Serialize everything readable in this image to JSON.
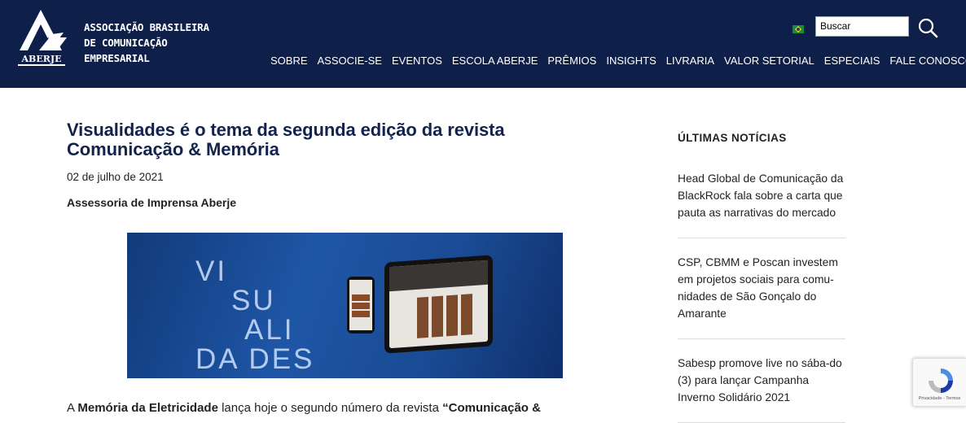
{
  "header": {
    "logo_text": "ABERJE",
    "org_name": [
      "ASSOCIAÇÃO BRASILEIRA",
      "DE COMUNICAÇÃO",
      "EMPRESARIAL"
    ],
    "search_placeholder": "Buscar",
    "nav": [
      "SOBRE",
      "ASSOCIE-SE",
      "EVENTOS",
      "ESCOLA ABERJE",
      "PRÊMIOS",
      "INSIGHTS",
      "LIVRARIA",
      "VALOR SETORIAL",
      "ESPECIAIS",
      "FALE CONOSCO"
    ],
    "colors": {
      "bg": "#0e1f4a",
      "text": "#ffffff"
    }
  },
  "article": {
    "title": "Visualidades é o tema da segunda edição da revista Comunicação & Memória",
    "date": "02 de julho de 2021",
    "author": "Assessoria de Imprensa Aberje",
    "hero_word": [
      "VI",
      "SU",
      "ALI",
      "DA DES"
    ],
    "body_start": {
      "a": "A ",
      "b": "Memória da Eletricidade",
      "c": " lança hoje o segundo número da revista ",
      "d": "“Comunicação &"
    }
  },
  "sidebar": {
    "title": "ÚLTIMAS NOTÍCIAS",
    "items": [
      {
        "label": "Head Global de Comunicação da BlackRock fala sobre a carta que pauta as narrativas do mercado"
      },
      {
        "label": "CSP, CBMM e Poscan investem em projetos sociais para comu-nidades de São Gonçalo do Amarante"
      },
      {
        "label": "Sabesp promove live no sába-do (3) para lançar Campanha Inverno Solidário 2021"
      }
    ]
  },
  "recaptcha": {
    "text": "Privacidade - Termos"
  }
}
